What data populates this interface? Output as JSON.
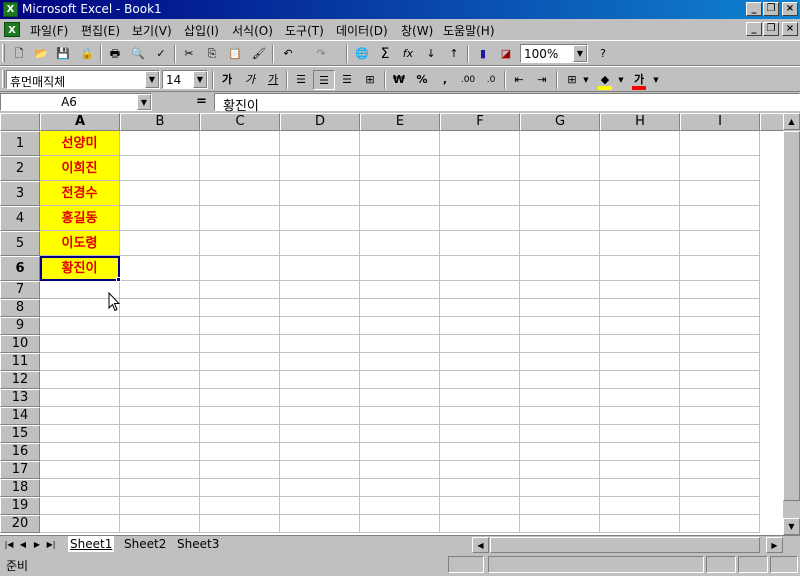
{
  "window": {
    "title": "Microsoft Excel - Book1",
    "app_icon_letter": "X",
    "minimize_label": "_",
    "restore_label": "❐",
    "close_label": "×"
  },
  "menu": {
    "items": [
      "파일(F)",
      "편집(E)",
      "보기(V)",
      "삽입(I)",
      "서식(O)",
      "도구(T)",
      "데이터(D)",
      "창(W)",
      "도움말(H)"
    ]
  },
  "standard_toolbar": {
    "zoom": "100%",
    "icons": [
      "new-icon",
      "open-icon",
      "save-icon",
      "permission-icon",
      "print-icon",
      "print-preview-icon",
      "spelling-icon",
      "cut-icon",
      "copy-icon",
      "paste-icon",
      "format-painter-icon",
      "undo-icon",
      "redo-icon",
      "hyperlink-icon",
      "autosum-icon",
      "function-icon",
      "sort-ascending-icon",
      "sort-descending-icon",
      "chart-wizard-icon",
      "drawing-icon",
      "help-icon"
    ],
    "glyphs": {
      "new": "🗋",
      "open": "📂",
      "save": "💾",
      "perm": "🔒",
      "print": "🖶",
      "preview": "🔍",
      "spell": "✓",
      "cut": "✂",
      "copy": "⎘",
      "paste": "📋",
      "painter": "🖌",
      "undo": "↶",
      "redo": "↷",
      "hyperlink": "🌐",
      "sum": "Σ",
      "fx": "fx",
      "sort_asc": "↓",
      "sort_desc": "↑",
      "chart": "▮",
      "map": "◪",
      "help": "?"
    }
  },
  "formatting_toolbar": {
    "font_name": "휴먼매직체",
    "font_size": "14",
    "bold": "가",
    "italic": "가",
    "underline": "가",
    "currency": "₩",
    "percent": "%",
    "comma": ",",
    "inc_decimal": ".00",
    "dec_decimal": ".0",
    "fill_color": "#ffff00",
    "font_color": "#ff0000",
    "font_color_glyph": "가"
  },
  "formula_bar": {
    "name_box": "A6",
    "equals": "=",
    "formula": "황진이"
  },
  "grid": {
    "columns": [
      "A",
      "B",
      "C",
      "D",
      "E",
      "F",
      "G",
      "H",
      "I"
    ],
    "rows": [
      "1",
      "2",
      "3",
      "4",
      "5",
      "6",
      "7",
      "8",
      "9",
      "10",
      "11",
      "12",
      "13",
      "14",
      "15",
      "16",
      "17",
      "18",
      "19",
      "20"
    ],
    "active_cell": "A6",
    "cells": {
      "A1": "선양미",
      "A2": "이희진",
      "A3": "전경수",
      "A4": "홍길동",
      "A5": "이도령",
      "A6": "황진이"
    },
    "fill_color": "#ffff00",
    "text_color": "#e00000"
  },
  "sheet_tabs": [
    "Sheet1",
    "Sheet2",
    "Sheet3"
  ],
  "active_sheet": "Sheet1",
  "status": {
    "text": "준비"
  }
}
